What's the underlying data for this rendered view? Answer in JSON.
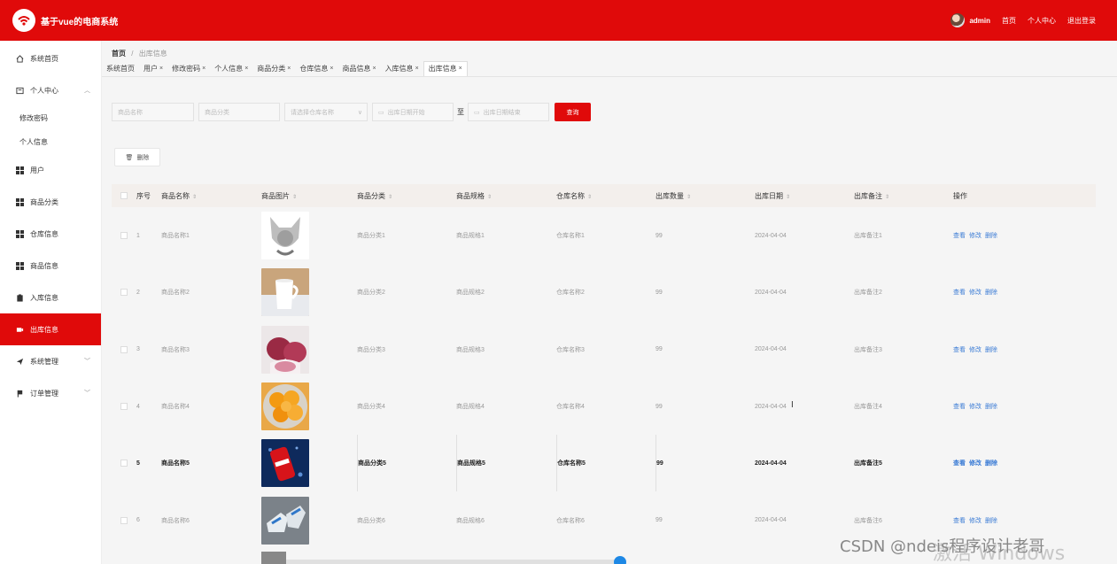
{
  "header": {
    "brand": "基于vue的电商系统",
    "user": "admin",
    "links": [
      "首页",
      "个人中心",
      "退出登录"
    ],
    "bg_color": "#e00a0a"
  },
  "sidebar": {
    "items": [
      {
        "label": "系统首页",
        "icon": "home-icon"
      },
      {
        "label": "个人中心",
        "icon": "user-center-icon",
        "expanded": true
      },
      {
        "label": "修改密码",
        "sub": true
      },
      {
        "label": "个人信息",
        "sub": true
      },
      {
        "label": "用户",
        "icon": "grid-icon"
      },
      {
        "label": "商品分类",
        "icon": "grid-icon"
      },
      {
        "label": "仓库信息",
        "icon": "grid-icon"
      },
      {
        "label": "商品信息",
        "icon": "grid-icon"
      },
      {
        "label": "入库信息",
        "icon": "clipboard-icon"
      },
      {
        "label": "出库信息",
        "icon": "outbound-icon",
        "active": true
      },
      {
        "label": "系统管理",
        "icon": "send-icon",
        "collapsed": true
      },
      {
        "label": "订单管理",
        "icon": "flag-icon",
        "collapsed": true
      }
    ]
  },
  "breadcrumb": {
    "home": "首页",
    "sep": "/",
    "current": "出库信息"
  },
  "tags": [
    {
      "label": "系统首页",
      "closable": false
    },
    {
      "label": "用户",
      "closable": true
    },
    {
      "label": "修改密码",
      "closable": true
    },
    {
      "label": "个人信息",
      "closable": true
    },
    {
      "label": "商品分类",
      "closable": true
    },
    {
      "label": "仓库信息",
      "closable": true
    },
    {
      "label": "商品信息",
      "closable": true
    },
    {
      "label": "入库信息",
      "closable": true
    },
    {
      "label": "出库信息",
      "closable": true,
      "active": true
    }
  ],
  "search": {
    "name_placeholder": "商品名称",
    "category_placeholder": "商品分类",
    "warehouse_placeholder": "请选择仓库名称",
    "date_start_placeholder": "出库日期开始",
    "to_label": "至",
    "date_end_placeholder": "出库日期结束",
    "button": "查询"
  },
  "toolbar": {
    "delete": "删除"
  },
  "table": {
    "headers": [
      "序号",
      "商品名称",
      "商品图片",
      "商品分类",
      "商品规格",
      "仓库名称",
      "出库数量",
      "出库日期",
      "出库备注",
      "操作"
    ],
    "ops": [
      "查看",
      "修改",
      "删除"
    ],
    "rows": [
      {
        "idx": "1",
        "name": "商品名称1",
        "img": "figurine",
        "cat": "商品分类1",
        "spec": "商品规格1",
        "wh": "仓库名称1",
        "qty": "99",
        "date": "2024-04-04",
        "note": "出库备注1"
      },
      {
        "idx": "2",
        "name": "商品名称2",
        "img": "mug",
        "cat": "商品分类2",
        "spec": "商品规格2",
        "wh": "仓库名称2",
        "qty": "99",
        "date": "2024-04-04",
        "note": "出库备注2"
      },
      {
        "idx": "3",
        "name": "商品名称3",
        "img": "onions",
        "cat": "商品分类3",
        "spec": "商品规格3",
        "wh": "仓库名称3",
        "qty": "99",
        "date": "2024-04-04",
        "note": "出库备注3"
      },
      {
        "idx": "4",
        "name": "商品名称4",
        "img": "oranges",
        "cat": "商品分类4",
        "spec": "商品规格4",
        "wh": "仓库名称4",
        "qty": "99",
        "date": "2024-04-04",
        "note": "出库备注4"
      },
      {
        "idx": "5",
        "name": "商品名称5",
        "img": "cola",
        "cat": "商品分类5",
        "spec": "商品规格5",
        "wh": "仓库名称5",
        "qty": "99",
        "date": "2024-04-04",
        "note": "出库备注5",
        "hover": true
      },
      {
        "idx": "6",
        "name": "商品名称6",
        "img": "sneakers",
        "cat": "商品分类6",
        "spec": "商品规格6",
        "wh": "仓库名称6",
        "qty": "99",
        "date": "2024-04-04",
        "note": "出库备注6"
      }
    ]
  },
  "overlay": {
    "csdn": "CSDN @ndeis程序设计老哥",
    "windows": "激活 Windows"
  }
}
